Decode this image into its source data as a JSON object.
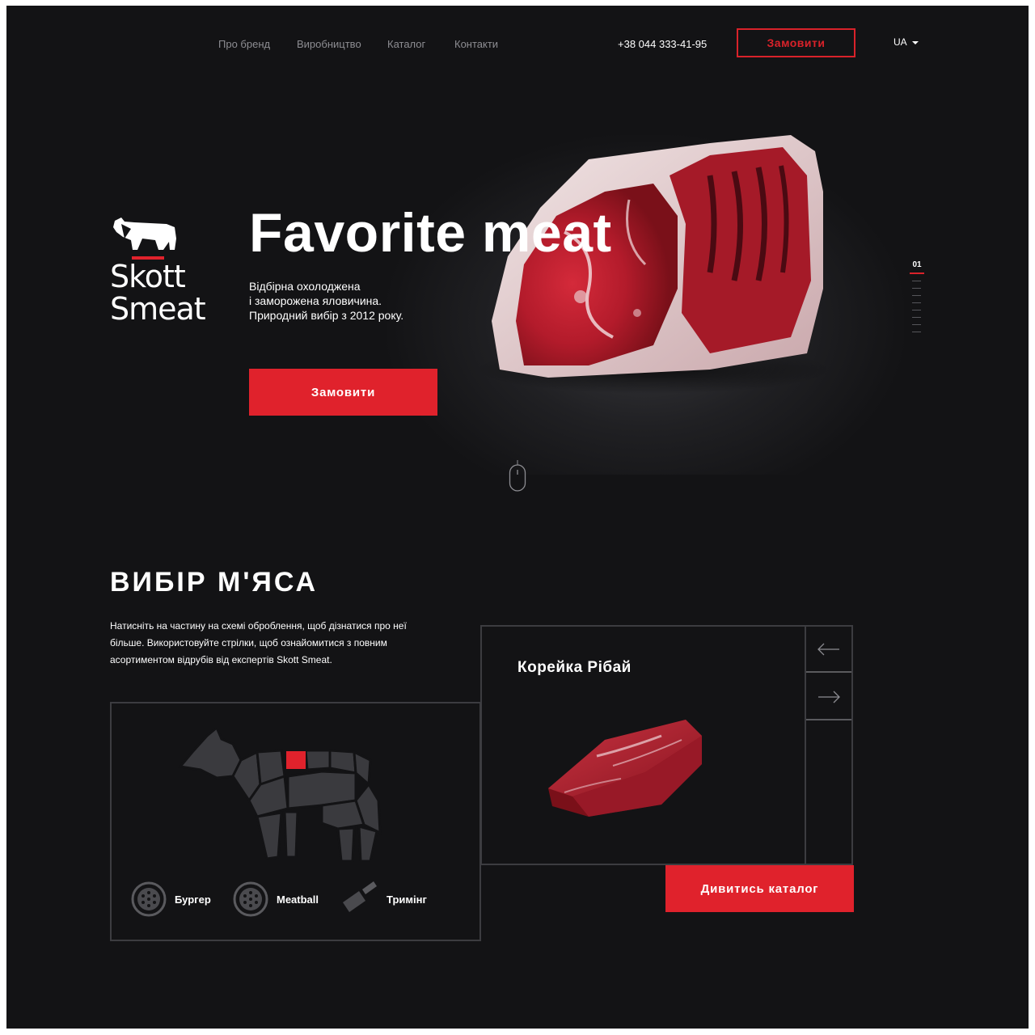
{
  "nav": {
    "links": [
      "Про бренд",
      "Виробництво",
      "Каталог",
      "Контакти"
    ],
    "phone": "+38 044 333-41-95",
    "order_label": "Замовити",
    "language": "UA"
  },
  "brand": {
    "line1": "Skott",
    "line2": "Smeat"
  },
  "hero": {
    "title": "Favorite meat",
    "subtitle_lines": [
      "Відбірна охолоджена",
      "і заморожена яловичина.",
      "Природний вибір з 2012 року."
    ],
    "button_label": "Замовити",
    "slide_number": "01",
    "slide_count": 9,
    "active_slide": 1
  },
  "selection": {
    "title": "ВИБІР М'ЯСА",
    "description": "Натисніть на частину на схемі оброблення, щоб дізнатися про неї більше. Використовуйте стрілки, щоб ознайомитися з повним асортиментом відрубів від експертів Skott Smeat.",
    "types": [
      {
        "label": "Бургер",
        "icon": "grinder-icon"
      },
      {
        "label": "Meatball",
        "icon": "grinder-icon"
      },
      {
        "label": "Тримінг",
        "icon": "cleaver-icon"
      }
    ],
    "product_name": "Корейка Рібай",
    "catalog_button": "Дивитись каталог"
  },
  "colors": {
    "accent": "#e0222c",
    "background": "#131315",
    "panel_border": "#3c3c40",
    "cow": "#3a3a3e"
  }
}
